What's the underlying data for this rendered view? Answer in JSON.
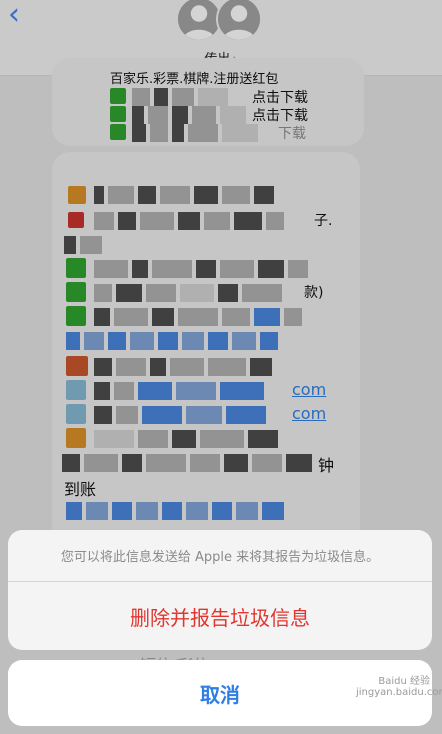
{
  "header": {
    "back_glyph": "‹",
    "contact_name": "传出",
    "contact_chevron": "›",
    "avatar_icon": "person-silhouette-icon"
  },
  "messages": {
    "bubble1": {
      "line_top": "百家乐.彩票.棋牌.注册送红包",
      "line_dl1": "点击下载",
      "line_dl2": "点击下载",
      "line_dl3": "下载"
    },
    "bubble2": {
      "text_zi": "子.",
      "text_kuan": "款)",
      "link1": "com",
      "link2": "com",
      "text_zhong": "钟",
      "text_daozhang": "到账"
    }
  },
  "sheet": {
    "message": "您可以将此信息发送给 Apple 来将其报告为垃圾信息。",
    "destructive_label": "删除并报告垃圾信息",
    "cancel_label": "取消",
    "destructive_color": "#e0362f",
    "cancel_color": "#2f7ee6"
  },
  "composer": {
    "placeholder": "短信/彩信"
  },
  "watermark": {
    "text": "Baidu 经验",
    "sub": "jingyan.baidu.com"
  }
}
